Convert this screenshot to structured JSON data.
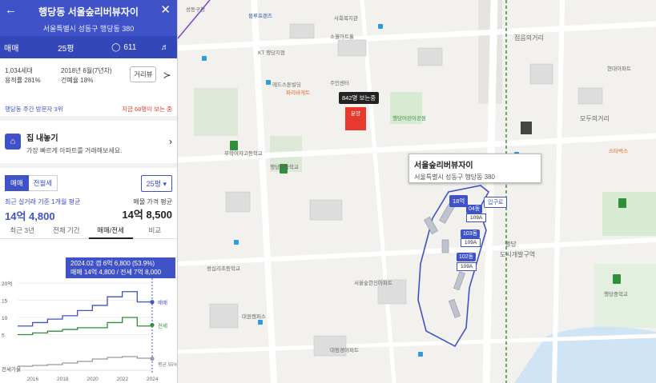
{
  "header": {
    "title": "행당동 서울숲리버뷰자이",
    "address": "서울특별시 성동구 행당동 380"
  },
  "subbar": {
    "deal_type": "매매",
    "area": "25평",
    "chat_count": "611"
  },
  "info": {
    "households": "1,034세대",
    "floor_area_ratio": "용적률 281%",
    "built": "2018년 6월(7년차)",
    "coverage_ratio": "건폐율 18%",
    "road_view": "거리뷰"
  },
  "rank": {
    "left": "행당동 주간 방문자 3위",
    "right": "지금 68명이 보는 중"
  },
  "promo": {
    "title": "집 내놓기",
    "subtitle": "가장 빠르게 아파트를 거래해보세요."
  },
  "trade_tabs": {
    "sale": "매매",
    "jeonse": "전월세",
    "area_select": "25평"
  },
  "prices": {
    "recent_label": "최근 실거래 기준 1개월 평균",
    "recent_value": "14억 4,800",
    "ask_label": "매물 가격 평균",
    "ask_value": "14억 8,500"
  },
  "period_tabs": [
    "최근 3년",
    "전체 기간",
    "매매/전세",
    "비교"
  ],
  "tooltip": {
    "line1": "2024.02 갭 6억 6,800 (53.9%)",
    "line2": "매매 14억 4,800 / 전세 7억 8,000"
  },
  "chart_data": {
    "type": "line",
    "x": [
      2015,
      2016,
      2017,
      2018,
      2019,
      2020,
      2021,
      2022,
      2023,
      2024
    ],
    "xticks": [
      "2016",
      "2018",
      "2020",
      "2022",
      "2024"
    ],
    "yticks": [
      "20억",
      "15",
      "10",
      "5"
    ],
    "series": [
      {
        "name": "매매",
        "color": "#3f52c8",
        "values": [
          7.5,
          8.5,
          9.5,
          10.5,
          12.0,
          13.5,
          16.0,
          17.5,
          14.5,
          14.48
        ]
      },
      {
        "name": "전세",
        "color": "#2f8f3a",
        "values": [
          5.0,
          5.5,
          6.0,
          6.5,
          7.0,
          7.0,
          8.5,
          10.0,
          7.5,
          7.8
        ]
      },
      {
        "name": "",
        "color": "#999999",
        "values": [
          2.0,
          2.5,
          3.0,
          4.0,
          5.0,
          6.5,
          7.5,
          8.0,
          7.0,
          6.68
        ]
      }
    ],
    "bottom_label": "전세가율",
    "ratio_label": "평균 55%",
    "ylim": [
      0,
      20
    ]
  },
  "map": {
    "callout_name": "서울숲리버뷰자이",
    "callout_addr": "서울특별시 성동구 행당동 380",
    "viewers_pin": "842명 보는중",
    "sale_pin": "분양",
    "markers": [
      "18억",
      "04동",
      "109A",
      "103동",
      "109A",
      "102동",
      "109A"
    ],
    "zoom_btn": "입구로",
    "labels": {
      "seongdong_station": "성동구청",
      "hwang_bridge": "블루프랜즈",
      "school1": "행당중학교",
      "park1": "행당어린이공원",
      "shop": "스타벅스",
      "square": "모두의거리",
      "district": "도시개발구역",
      "haengdang": "행당",
      "apt1": "서울숲한진아파트",
      "apt2": "대원캠퍼스",
      "apt3": "대림경아파트",
      "a1": "사회복지관",
      "a2": "주민센터",
      "a3": "레드스톤빌딩",
      "a4": "파리바게트",
      "a5": "행당초등학교",
      "a6": "왕십리초등학교",
      "a7": "무학여자고등학교",
      "a8": "점음의거리",
      "a9": "현대아파트",
      "a10": "행당중학교",
      "a11": "KT 행당지점",
      "a12": "소월아트홀"
    }
  }
}
